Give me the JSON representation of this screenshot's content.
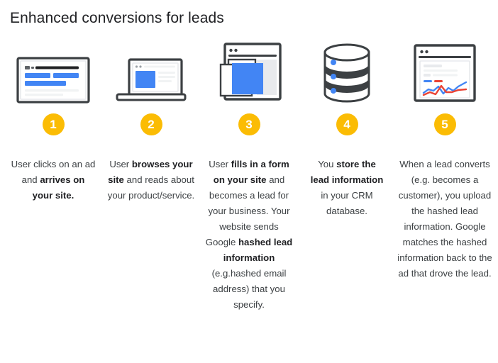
{
  "header": {
    "title": "Enhanced conversions for leads"
  },
  "colors": {
    "badge_yellow": "#fbbc04",
    "accent_blue": "#4285f4",
    "accent_red": "#ea4335",
    "outline_dark": "#3c4043",
    "text": "#3c4043"
  },
  "steps": [
    {
      "number": "1",
      "icon": "search-results-window-icon",
      "caption_parts": [
        {
          "text": "User clicks on an ad and ",
          "bold": false
        },
        {
          "text": "arrives on your site.",
          "bold": true
        }
      ],
      "caption_plain": "User clicks on an ad and arrives on your site."
    },
    {
      "number": "2",
      "icon": "laptop-icon",
      "caption_parts": [
        {
          "text": "User ",
          "bold": false
        },
        {
          "text": "browses your site",
          "bold": true
        },
        {
          "text": " and reads about your product/service.",
          "bold": false
        }
      ],
      "caption_plain": "User browses your site and reads about your product/service."
    },
    {
      "number": "3",
      "icon": "web-form-window-icon",
      "caption_parts": [
        {
          "text": "User ",
          "bold": false
        },
        {
          "text": "fills in a form on your site",
          "bold": true
        },
        {
          "text": " and becomes a lead for your business. Your website sends Google ",
          "bold": false
        },
        {
          "text": "hashed lead information",
          "bold": true
        },
        {
          "text": " (e.g.hashed email address) that you specify.",
          "bold": false
        }
      ],
      "caption_plain": "User fills in a form on your site and becomes a lead for your business. Your website sends Google hashed lead information (e.g.hashed email address) that you specify."
    },
    {
      "number": "4",
      "icon": "database-icon",
      "caption_parts": [
        {
          "text": "You ",
          "bold": false
        },
        {
          "text": "store the lead information",
          "bold": true
        },
        {
          "text": " in your CRM database.",
          "bold": false
        }
      ],
      "caption_plain": "You store the lead information in your CRM database."
    },
    {
      "number": "5",
      "icon": "analytics-chart-window-icon",
      "caption_parts": [
        {
          "text": "When a lead converts (e.g. becomes a customer), you upload the hashed lead information. Google matches the hashed information back to the ad that drove the lead.",
          "bold": false
        }
      ],
      "caption_plain": "When a lead converts (e.g. becomes a customer), you upload the hashed lead information. Google matches the hashed information back to the ad that drove the lead."
    }
  ]
}
